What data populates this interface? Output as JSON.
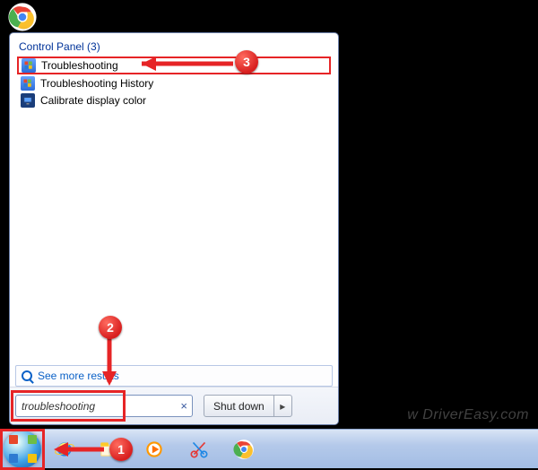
{
  "startMenu": {
    "categoryLabel": "Control Panel (3)",
    "results": [
      {
        "label": "Troubleshooting",
        "icon": "flag-icon",
        "highlighted": true
      },
      {
        "label": "Troubleshooting History",
        "icon": "flag-icon",
        "highlighted": false
      },
      {
        "label": "Calibrate display color",
        "icon": "monitor-icon",
        "highlighted": false
      }
    ],
    "seeMoreLabel": "See more results",
    "search": {
      "value": "troubleshooting",
      "clearGlyph": "×"
    },
    "shutdown": {
      "label": "Shut down",
      "arrowGlyph": "▸"
    }
  },
  "taskbar": {
    "items": [
      {
        "name": "start-button"
      },
      {
        "name": "internet-explorer-icon"
      },
      {
        "name": "file-explorer-icon"
      },
      {
        "name": "windows-media-player-icon"
      },
      {
        "name": "snipping-tool-icon"
      },
      {
        "name": "chrome-icon"
      }
    ]
  },
  "annotations": {
    "step1": "1",
    "step2": "2",
    "step3": "3"
  },
  "watermark": "w DriverEasy.com"
}
